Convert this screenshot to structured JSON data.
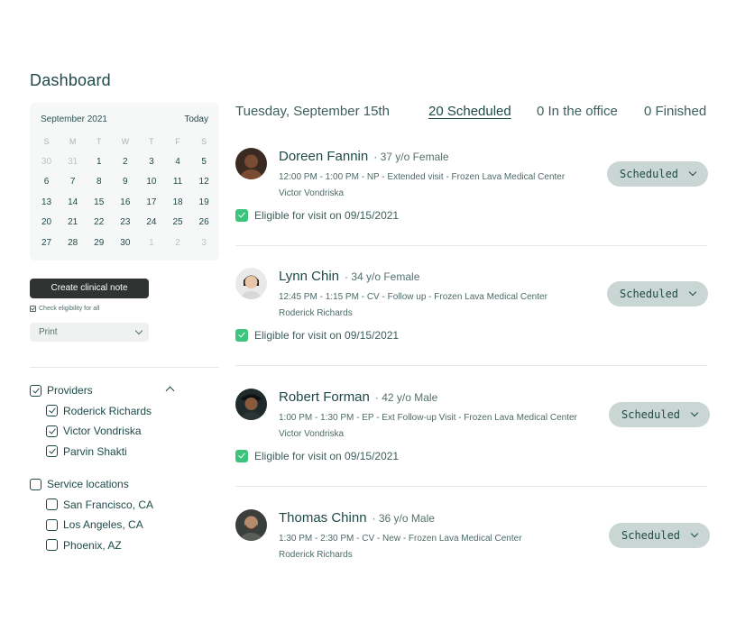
{
  "page": {
    "title": "Dashboard"
  },
  "calendar": {
    "month": "September 2021",
    "today_label": "Today",
    "weekdays": [
      "S",
      "M",
      "T",
      "W",
      "T",
      "F",
      "S"
    ],
    "weeks": [
      [
        {
          "d": "30",
          "m": true
        },
        {
          "d": "31",
          "m": true
        },
        {
          "d": "1"
        },
        {
          "d": "2"
        },
        {
          "d": "3"
        },
        {
          "d": "4"
        },
        {
          "d": "5"
        }
      ],
      [
        {
          "d": "6"
        },
        {
          "d": "7"
        },
        {
          "d": "8"
        },
        {
          "d": "9"
        },
        {
          "d": "10"
        },
        {
          "d": "11"
        },
        {
          "d": "12"
        }
      ],
      [
        {
          "d": "13"
        },
        {
          "d": "14"
        },
        {
          "d": "15"
        },
        {
          "d": "16"
        },
        {
          "d": "17"
        },
        {
          "d": "18"
        },
        {
          "d": "19"
        }
      ],
      [
        {
          "d": "20"
        },
        {
          "d": "21"
        },
        {
          "d": "22"
        },
        {
          "d": "23"
        },
        {
          "d": "24"
        },
        {
          "d": "25"
        },
        {
          "d": "26"
        }
      ],
      [
        {
          "d": "27"
        },
        {
          "d": "28"
        },
        {
          "d": "29"
        },
        {
          "d": "30"
        },
        {
          "d": "1",
          "m": true
        },
        {
          "d": "2",
          "m": true
        },
        {
          "d": "3",
          "m": true
        }
      ]
    ]
  },
  "actions": {
    "create_note": "Create clinical note",
    "check_eligibility": "Check eligibility for all",
    "print": "Print"
  },
  "filters": {
    "providers": {
      "label": "Providers",
      "checked": true,
      "items": [
        {
          "label": "Roderick Richards",
          "checked": true
        },
        {
          "label": "Victor Vondriska",
          "checked": true
        },
        {
          "label": "Parvin Shakti",
          "checked": true
        }
      ]
    },
    "locations": {
      "label": "Service locations",
      "checked": false,
      "items": [
        {
          "label": "San Francisco, CA",
          "checked": false
        },
        {
          "label": "Los Angeles, CA",
          "checked": false
        },
        {
          "label": "Phoenix, AZ",
          "checked": false
        }
      ]
    }
  },
  "main": {
    "date": "Tuesday, September 15th",
    "tabs": [
      {
        "label": "20 Scheduled",
        "active": true
      },
      {
        "label": "0 In the office",
        "active": false
      },
      {
        "label": "0 Finished",
        "active": false
      }
    ],
    "appointments": [
      {
        "name": "Doreen Fannin",
        "meta": "· 37 y/o Female",
        "detail": "12:00 PM - 1:00 PM - NP - Extended visit - Frozen Lava Medical Center",
        "provider": "Victor Vondriska",
        "eligibility": "Eligible for visit on 09/15/2021",
        "status": "Scheduled",
        "avatar": {
          "bg": "#3a2a22",
          "skin": "#7a4a32"
        }
      },
      {
        "name": "Lynn Chin",
        "meta": "· 34 y/o Female",
        "detail": "12:45 PM - 1:15 PM - CV - Follow up - Frozen Lava Medical Center",
        "provider": "Roderick Richards",
        "eligibility": "Eligible for visit on 09/15/2021",
        "status": "Scheduled",
        "avatar": {
          "bg": "#e9e9e9",
          "skin": "#e8c6a8"
        }
      },
      {
        "name": "Robert Forman",
        "meta": "· 42 y/o Male",
        "detail": "1:00 PM - 1:30 PM - EP - Ext Follow-up Visit - Frozen Lava Medical Center",
        "provider": "Victor Vondriska",
        "eligibility": "Eligible for visit on 09/15/2021",
        "status": "Scheduled",
        "avatar": {
          "bg": "#1f2a2a",
          "skin": "#8a5a3c"
        }
      },
      {
        "name": "Thomas Chinn",
        "meta": "· 36 y/o Male",
        "detail": "1:30 PM - 2:30 PM - CV - New - Frozen Lava Medical Center",
        "provider": "Roderick Richards",
        "eligibility": "",
        "status": "Scheduled",
        "avatar": {
          "bg": "#3b3f3c",
          "skin": "#b68a6c"
        }
      }
    ]
  }
}
